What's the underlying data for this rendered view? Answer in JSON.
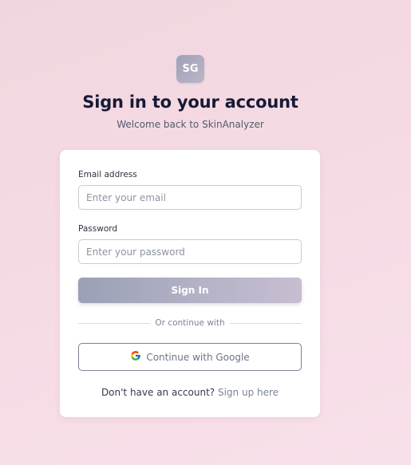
{
  "brand": {
    "logo_text": "SG"
  },
  "header": {
    "title": "Sign in to your account",
    "subtitle": "Welcome back to SkinAnalyzer"
  },
  "form": {
    "email_label": "Email address",
    "email_placeholder": "Enter your email",
    "email_value": "",
    "password_label": "Password",
    "password_placeholder": "Enter your password",
    "password_value": "",
    "submit_label": "Sign In"
  },
  "divider_text": "Or continue with",
  "google_button": {
    "label": "Continue with Google",
    "icon": "google-g-icon"
  },
  "footer": {
    "prompt": "Don't have an account?",
    "link": "Sign up here"
  },
  "colors": {
    "background": "#f5dbe4",
    "accent": "#9aa0b6",
    "title": "#161a36",
    "link": "#7a8398"
  }
}
